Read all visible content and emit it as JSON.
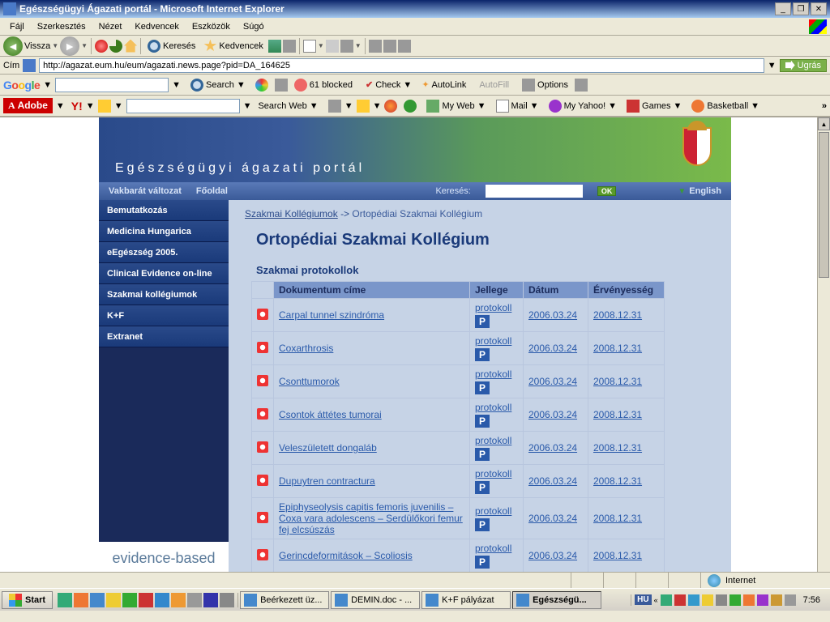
{
  "window": {
    "title": "Egészségügyi Ágazati portál - Microsoft Internet Explorer"
  },
  "menu": {
    "items": [
      "Fájl",
      "Szerkesztés",
      "Nézet",
      "Kedvencek",
      "Eszközök",
      "Súgó"
    ]
  },
  "nav_toolbar": {
    "back": "Vissza",
    "search": "Keresés",
    "favorites": "Kedvencek"
  },
  "address": {
    "label": "Cím",
    "url": "http://agazat.eum.hu/eum/agazati.news.page?pid=DA_164625",
    "go": "Ugrás"
  },
  "google_bar": {
    "search": "Search",
    "blocked": "61 blocked",
    "check": "Check",
    "autolink": "AutoLink",
    "autofill": "AutoFill",
    "options": "Options"
  },
  "adobe_yahoo_bar": {
    "adobe": "Adobe",
    "y": "Y!",
    "search_web": "Search Web",
    "myweb": "My Web",
    "mail": "Mail",
    "myyahoo": "My Yahoo!",
    "games": "Games",
    "basketball": "Basketball"
  },
  "portal": {
    "title": "Egészségügyi ágazati portál",
    "subnav": {
      "accessible": "Vakbarát változat",
      "home": "Főoldal",
      "search_label": "Keresés:",
      "ok": "OK",
      "language": "English"
    },
    "sidebar": [
      "Bemutatkozás",
      "Medicina Hungarica",
      "eEgészség 2005.",
      "Clinical Evidence on-line",
      "Szakmai kollégiumok",
      "K+F",
      "Extranet"
    ],
    "sidebar_banner": "evidence-based",
    "breadcrumb": {
      "root": "Szakmai Kollégiumok",
      "sep": "->",
      "current": "Ortopédiai Szakmai Kollégium"
    },
    "page_heading": "Ortopédiai Szakmai Kollégium",
    "section_heading": "Szakmai protokollok",
    "table": {
      "headers": [
        "Dokumentum címe",
        "Jellege",
        "Dátum",
        "Érvényesség"
      ],
      "type_label": "protokoll",
      "p_icon": "P",
      "rows": [
        {
          "title": "Carpal tunnel szindróma",
          "date": "2006.03.24",
          "valid": "2008.12.31"
        },
        {
          "title": "Coxarthrosis",
          "date": "2006.03.24",
          "valid": "2008.12.31"
        },
        {
          "title": "Csonttumorok",
          "date": "2006.03.24",
          "valid": "2008.12.31"
        },
        {
          "title": "Csontok áttétes tumorai",
          "date": "2006.03.24",
          "valid": "2008.12.31"
        },
        {
          "title": "Veleszületett dongaláb",
          "date": "2006.03.24",
          "valid": "2008.12.31"
        },
        {
          "title": "Dupuytren contractura",
          "date": "2006.03.24",
          "valid": "2008.12.31"
        },
        {
          "title": "Epiphyseolysis capitis femoris juvenilis – Coxa vara adolescens – Serdülőkori femur fej elcsúszás",
          "date": "2006.03.24",
          "valid": "2008.12.31"
        },
        {
          "title": "Gerincdeformitások – Scoliosis",
          "date": "2006.03.24",
          "valid": "2008.12.31"
        }
      ]
    }
  },
  "statusbar": {
    "zone": "Internet"
  },
  "taskbar": {
    "start": "Start",
    "tasks": [
      {
        "label": "Beérkezett üz...",
        "active": false
      },
      {
        "label": "DEMIN.doc - ...",
        "active": false
      },
      {
        "label": "K+F pályázat",
        "active": false
      },
      {
        "label": "Egészségü...",
        "active": true
      }
    ],
    "lang": "HU",
    "clock": "7:56"
  }
}
